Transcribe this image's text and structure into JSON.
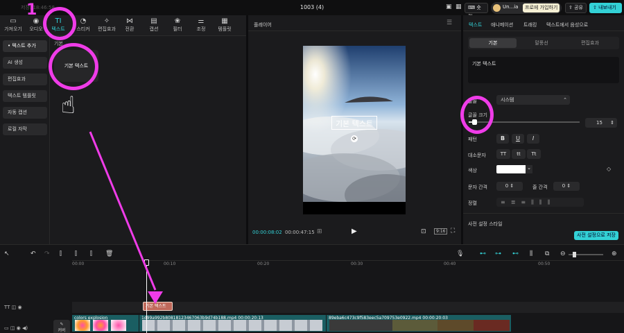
{
  "app": {
    "title": "1003 (4)",
    "tabs_faded": "저장: 18:46:58"
  },
  "topbar": {
    "shortcut_label": "숏컷",
    "account_label": "Un...ia",
    "pro_label": "프로에 가입하기",
    "share_label": "공유",
    "export_label": "내보내기"
  },
  "toolbar": {
    "items": [
      {
        "label": "가져오기",
        "icon": "import-icon"
      },
      {
        "label": "오디오",
        "icon": "audio-icon"
      },
      {
        "label": "텍스트",
        "icon": "text-icon"
      },
      {
        "label": "스티커",
        "icon": "sticker-icon"
      },
      {
        "label": "편집효과",
        "icon": "effects-icon"
      },
      {
        "label": "전환",
        "icon": "transition-icon"
      },
      {
        "label": "캡션",
        "icon": "caption-icon"
      },
      {
        "label": "필터",
        "icon": "filter-icon"
      },
      {
        "label": "조정",
        "icon": "adjust-icon"
      },
      {
        "label": "템플릿",
        "icon": "template-icon"
      }
    ]
  },
  "sidenav": {
    "items": [
      "• 텍스트 추가",
      "AI 생성",
      "편집효과",
      "텍스트 템플릿",
      "자동 캡션",
      "로컬 자막"
    ]
  },
  "content": {
    "section_label": "기본",
    "card_label": "기본 텍스트"
  },
  "player": {
    "title": "플레이어",
    "overlay_text": "기본 텍스트",
    "current_time": "00:00:08:02",
    "total_time": "00:00:47:15",
    "aspect": "9:16"
  },
  "props": {
    "tabs": [
      "텍스트",
      "애니메이션",
      "트래킹",
      "텍스트에서 음성으로"
    ],
    "subtabs": [
      "기본",
      "말풍선",
      "편집효과"
    ],
    "text_value": "기본 텍스트",
    "font_label": "글꼴",
    "font_value": "시스템",
    "size_label": "글꼴 크기",
    "size_value": "15",
    "size_slider_level": 0.05,
    "pattern_label": "패턴",
    "style_buttons": [
      "B",
      "U",
      "I"
    ],
    "case_label": "대소문자",
    "case_buttons": [
      "TT",
      "tt",
      "Tt"
    ],
    "color_label": "색상",
    "color_value": "#ffffff",
    "spacing_label": "문자 간격",
    "spacing_value": "0",
    "line_label": "줄 간격",
    "line_value": "0",
    "align_label": "정렬",
    "preset_label": "사전 설정 스타일",
    "save_preset_label": "사전 설정으로 저장"
  },
  "timeline": {
    "ruler": [
      "00:00",
      "00:10",
      "00:20",
      "00:30",
      "00:40",
      "00:50"
    ],
    "text_clip_label": "기본 텍스트",
    "clip1_label": "colors explosion",
    "clip2_label": "1d99a992b80818123467063b9d74b188.mp4  00:00:20:13",
    "clip3_label": "89eba6c473c9f583eec5a709753e0922.mp4  00:00:20:03",
    "cover_label": "커버",
    "annotation_number": "1",
    "accent": "#33d1d6",
    "annotation_color": "#ef3ce8"
  }
}
